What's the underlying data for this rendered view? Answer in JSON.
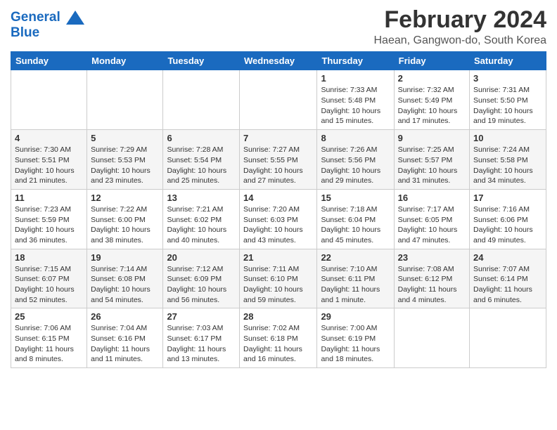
{
  "header": {
    "logo_line1": "General",
    "logo_line2": "Blue",
    "month_title": "February 2024",
    "location": "Haean, Gangwon-do, South Korea"
  },
  "weekdays": [
    "Sunday",
    "Monday",
    "Tuesday",
    "Wednesday",
    "Thursday",
    "Friday",
    "Saturday"
  ],
  "weeks": [
    [
      {
        "day": "",
        "info": ""
      },
      {
        "day": "",
        "info": ""
      },
      {
        "day": "",
        "info": ""
      },
      {
        "day": "",
        "info": ""
      },
      {
        "day": "1",
        "info": "Sunrise: 7:33 AM\nSunset: 5:48 PM\nDaylight: 10 hours\nand 15 minutes."
      },
      {
        "day": "2",
        "info": "Sunrise: 7:32 AM\nSunset: 5:49 PM\nDaylight: 10 hours\nand 17 minutes."
      },
      {
        "day": "3",
        "info": "Sunrise: 7:31 AM\nSunset: 5:50 PM\nDaylight: 10 hours\nand 19 minutes."
      }
    ],
    [
      {
        "day": "4",
        "info": "Sunrise: 7:30 AM\nSunset: 5:51 PM\nDaylight: 10 hours\nand 21 minutes."
      },
      {
        "day": "5",
        "info": "Sunrise: 7:29 AM\nSunset: 5:53 PM\nDaylight: 10 hours\nand 23 minutes."
      },
      {
        "day": "6",
        "info": "Sunrise: 7:28 AM\nSunset: 5:54 PM\nDaylight: 10 hours\nand 25 minutes."
      },
      {
        "day": "7",
        "info": "Sunrise: 7:27 AM\nSunset: 5:55 PM\nDaylight: 10 hours\nand 27 minutes."
      },
      {
        "day": "8",
        "info": "Sunrise: 7:26 AM\nSunset: 5:56 PM\nDaylight: 10 hours\nand 29 minutes."
      },
      {
        "day": "9",
        "info": "Sunrise: 7:25 AM\nSunset: 5:57 PM\nDaylight: 10 hours\nand 31 minutes."
      },
      {
        "day": "10",
        "info": "Sunrise: 7:24 AM\nSunset: 5:58 PM\nDaylight: 10 hours\nand 34 minutes."
      }
    ],
    [
      {
        "day": "11",
        "info": "Sunrise: 7:23 AM\nSunset: 5:59 PM\nDaylight: 10 hours\nand 36 minutes."
      },
      {
        "day": "12",
        "info": "Sunrise: 7:22 AM\nSunset: 6:00 PM\nDaylight: 10 hours\nand 38 minutes."
      },
      {
        "day": "13",
        "info": "Sunrise: 7:21 AM\nSunset: 6:02 PM\nDaylight: 10 hours\nand 40 minutes."
      },
      {
        "day": "14",
        "info": "Sunrise: 7:20 AM\nSunset: 6:03 PM\nDaylight: 10 hours\nand 43 minutes."
      },
      {
        "day": "15",
        "info": "Sunrise: 7:18 AM\nSunset: 6:04 PM\nDaylight: 10 hours\nand 45 minutes."
      },
      {
        "day": "16",
        "info": "Sunrise: 7:17 AM\nSunset: 6:05 PM\nDaylight: 10 hours\nand 47 minutes."
      },
      {
        "day": "17",
        "info": "Sunrise: 7:16 AM\nSunset: 6:06 PM\nDaylight: 10 hours\nand 49 minutes."
      }
    ],
    [
      {
        "day": "18",
        "info": "Sunrise: 7:15 AM\nSunset: 6:07 PM\nDaylight: 10 hours\nand 52 minutes."
      },
      {
        "day": "19",
        "info": "Sunrise: 7:14 AM\nSunset: 6:08 PM\nDaylight: 10 hours\nand 54 minutes."
      },
      {
        "day": "20",
        "info": "Sunrise: 7:12 AM\nSunset: 6:09 PM\nDaylight: 10 hours\nand 56 minutes."
      },
      {
        "day": "21",
        "info": "Sunrise: 7:11 AM\nSunset: 6:10 PM\nDaylight: 10 hours\nand 59 minutes."
      },
      {
        "day": "22",
        "info": "Sunrise: 7:10 AM\nSunset: 6:11 PM\nDaylight: 11 hours\nand 1 minute."
      },
      {
        "day": "23",
        "info": "Sunrise: 7:08 AM\nSunset: 6:12 PM\nDaylight: 11 hours\nand 4 minutes."
      },
      {
        "day": "24",
        "info": "Sunrise: 7:07 AM\nSunset: 6:14 PM\nDaylight: 11 hours\nand 6 minutes."
      }
    ],
    [
      {
        "day": "25",
        "info": "Sunrise: 7:06 AM\nSunset: 6:15 PM\nDaylight: 11 hours\nand 8 minutes."
      },
      {
        "day": "26",
        "info": "Sunrise: 7:04 AM\nSunset: 6:16 PM\nDaylight: 11 hours\nand 11 minutes."
      },
      {
        "day": "27",
        "info": "Sunrise: 7:03 AM\nSunset: 6:17 PM\nDaylight: 11 hours\nand 13 minutes."
      },
      {
        "day": "28",
        "info": "Sunrise: 7:02 AM\nSunset: 6:18 PM\nDaylight: 11 hours\nand 16 minutes."
      },
      {
        "day": "29",
        "info": "Sunrise: 7:00 AM\nSunset: 6:19 PM\nDaylight: 11 hours\nand 18 minutes."
      },
      {
        "day": "",
        "info": ""
      },
      {
        "day": "",
        "info": ""
      }
    ]
  ]
}
